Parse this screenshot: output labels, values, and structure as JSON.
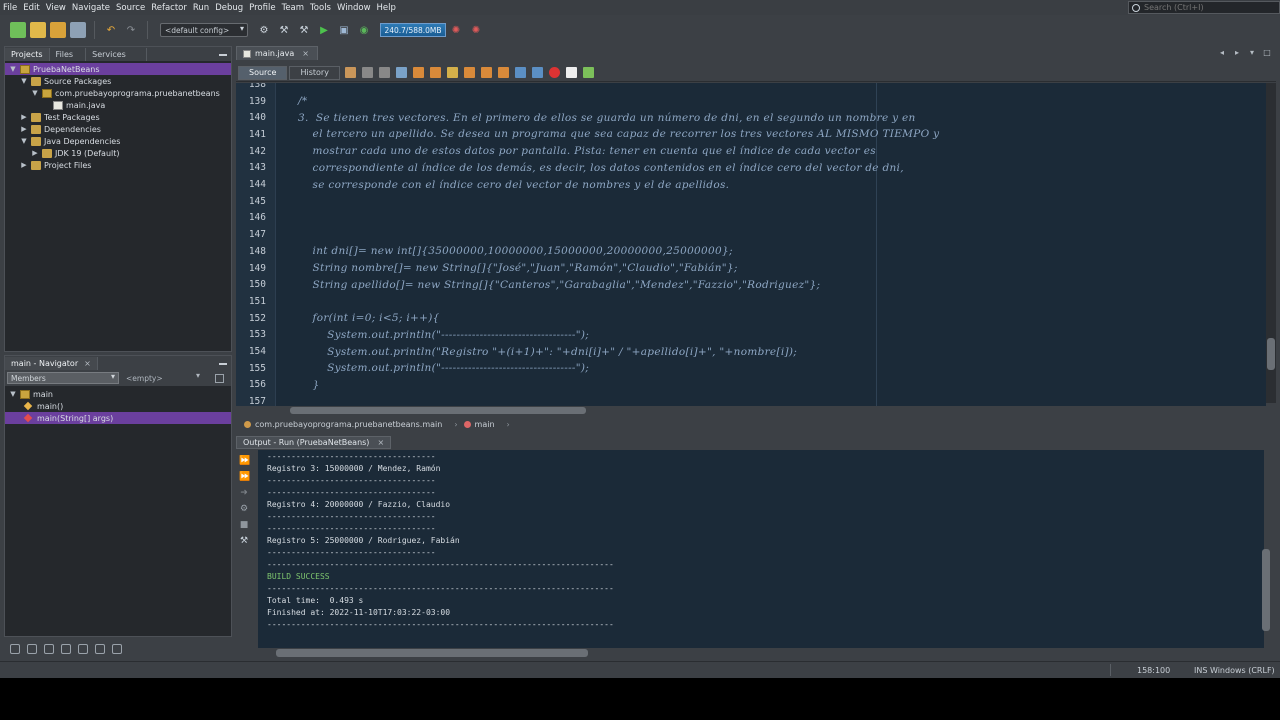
{
  "menu": [
    "File",
    "Edit",
    "View",
    "Navigate",
    "Source",
    "Refactor",
    "Run",
    "Debug",
    "Profile",
    "Team",
    "Tools",
    "Window",
    "Help"
  ],
  "search": {
    "placeholder": "Search (Ctrl+I)"
  },
  "toolbar": {
    "config": "<default config>",
    "memory": "240.7/588.0MB"
  },
  "projects_panel": {
    "tabs": [
      "Projects",
      "Files",
      "Services"
    ],
    "tree": [
      {
        "label": "PruebaNetBeans",
        "depth": 0,
        "icon": "project-icon",
        "twisty": "▼",
        "selected": true
      },
      {
        "label": "Source Packages",
        "depth": 1,
        "icon": "folder-icon",
        "twisty": "▼",
        "selected": false
      },
      {
        "label": "com.pruebayoprograma.pruebanetbeans",
        "depth": 2,
        "icon": "package-icon",
        "twisty": "▼",
        "selected": false
      },
      {
        "label": "main.java",
        "depth": 3,
        "icon": "java-file-icon",
        "twisty": "",
        "selected": false
      },
      {
        "label": "Test Packages",
        "depth": 1,
        "icon": "folder-icon",
        "twisty": "▶",
        "selected": false
      },
      {
        "label": "Dependencies",
        "depth": 1,
        "icon": "folder-icon",
        "twisty": "▶",
        "selected": false
      },
      {
        "label": "Java Dependencies",
        "depth": 1,
        "icon": "folder-icon",
        "twisty": "▼",
        "selected": false
      },
      {
        "label": "JDK 19 (Default)",
        "depth": 2,
        "icon": "jdk-icon",
        "twisty": "▶",
        "selected": false
      },
      {
        "label": "Project Files",
        "depth": 1,
        "icon": "folder-icon",
        "twisty": "▶",
        "selected": false
      }
    ]
  },
  "navigator": {
    "title": "main - Navigator",
    "filter": "Members",
    "empty": "<empty>",
    "items": [
      {
        "label": "main",
        "depth": 0,
        "kind": "class",
        "selected": false
      },
      {
        "label": "main()",
        "depth": 1,
        "kind": "constructor",
        "selected": false
      },
      {
        "label": "main(String[] args)",
        "depth": 1,
        "kind": "method",
        "selected": true
      }
    ]
  },
  "editor": {
    "file_tab": "main.java",
    "source_tab": "Source",
    "history_tab": "History",
    "lines": [
      {
        "n": "138",
        "text": ""
      },
      {
        "n": "139",
        "text": "/*"
      },
      {
        "n": "140",
        "text": "3.  Se tienen tres vectores. En el primero de ellos se guarda un número de dni, en el segundo un nombre y en"
      },
      {
        "n": "141",
        "text": "    el tercero un apellido. Se desea un programa que sea capaz de recorrer los tres vectores AL MISMO TIEMPO y"
      },
      {
        "n": "142",
        "text": "    mostrar cada uno de estos datos por pantalla. Pista: tener en cuenta que el índice de cada vector es"
      },
      {
        "n": "143",
        "text": "    correspondiente al índice de los demás, es decir, los datos contenidos en el índice cero del vector de dni,"
      },
      {
        "n": "144",
        "text": "    se corresponde con el índice cero del vector de nombres y el de apellidos."
      },
      {
        "n": "145",
        "text": ""
      },
      {
        "n": "146",
        "text": ""
      },
      {
        "n": "147",
        "text": ""
      },
      {
        "n": "148",
        "text": "    int dni[]= new int[]{35000000,10000000,15000000,20000000,25000000};"
      },
      {
        "n": "149",
        "text": "    String nombre[]= new String[]{\"José\",\"Juan\",\"Ramón\",\"Claudio\",\"Fabián\"};"
      },
      {
        "n": "150",
        "text": "    String apellido[]= new String[]{\"Canteros\",\"Garabaglia\",\"Mendez\",\"Fazzio\",\"Rodriguez\"};"
      },
      {
        "n": "151",
        "text": ""
      },
      {
        "n": "152",
        "text": "    for(int i=0; i<5; i++){"
      },
      {
        "n": "153",
        "text": "        System.out.println(\"-----------------------------------\");"
      },
      {
        "n": "154",
        "text": "        System.out.println(\"Registro \"+(i+1)+\": \"+dni[i]+\" / \"+apellido[i]+\", \"+nombre[i]);"
      },
      {
        "n": "155",
        "text": "        System.out.println(\"-----------------------------------\");"
      },
      {
        "n": "156",
        "text": "    }"
      },
      {
        "n": "157",
        "text": ""
      }
    ]
  },
  "breadcrumb": [
    "com.pruebayoprograma.pruebanetbeans.main",
    "main"
  ],
  "output": {
    "tab": "Output - Run (PruebaNetBeans)",
    "lines": [
      {
        "text": "-----------------------------------",
        "style": "normal"
      },
      {
        "text": "Registro 3: 15000000 / Mendez, Ramón",
        "style": "normal"
      },
      {
        "text": "-----------------------------------",
        "style": "normal"
      },
      {
        "text": "-----------------------------------",
        "style": "normal"
      },
      {
        "text": "Registro 4: 20000000 / Fazzio, Claudio",
        "style": "normal"
      },
      {
        "text": "-----------------------------------",
        "style": "normal"
      },
      {
        "text": "-----------------------------------",
        "style": "normal"
      },
      {
        "text": "Registro 5: 25000000 / Rodriguez, Fabián",
        "style": "normal"
      },
      {
        "text": "-----------------------------------",
        "style": "normal"
      },
      {
        "text": "------------------------------------------------------------------------",
        "style": "normal"
      },
      {
        "text": "BUILD SUCCESS",
        "style": "green"
      },
      {
        "text": "------------------------------------------------------------------------",
        "style": "normal"
      },
      {
        "text": "Total time:  0.493 s",
        "style": "normal"
      },
      {
        "text": "Finished at: 2022-11-10T17:03:22-03:00",
        "style": "normal"
      },
      {
        "text": "------------------------------------------------------------------------",
        "style": "normal"
      }
    ]
  },
  "status": {
    "position": "158:100",
    "mode": "INS Windows (CRLF)"
  }
}
